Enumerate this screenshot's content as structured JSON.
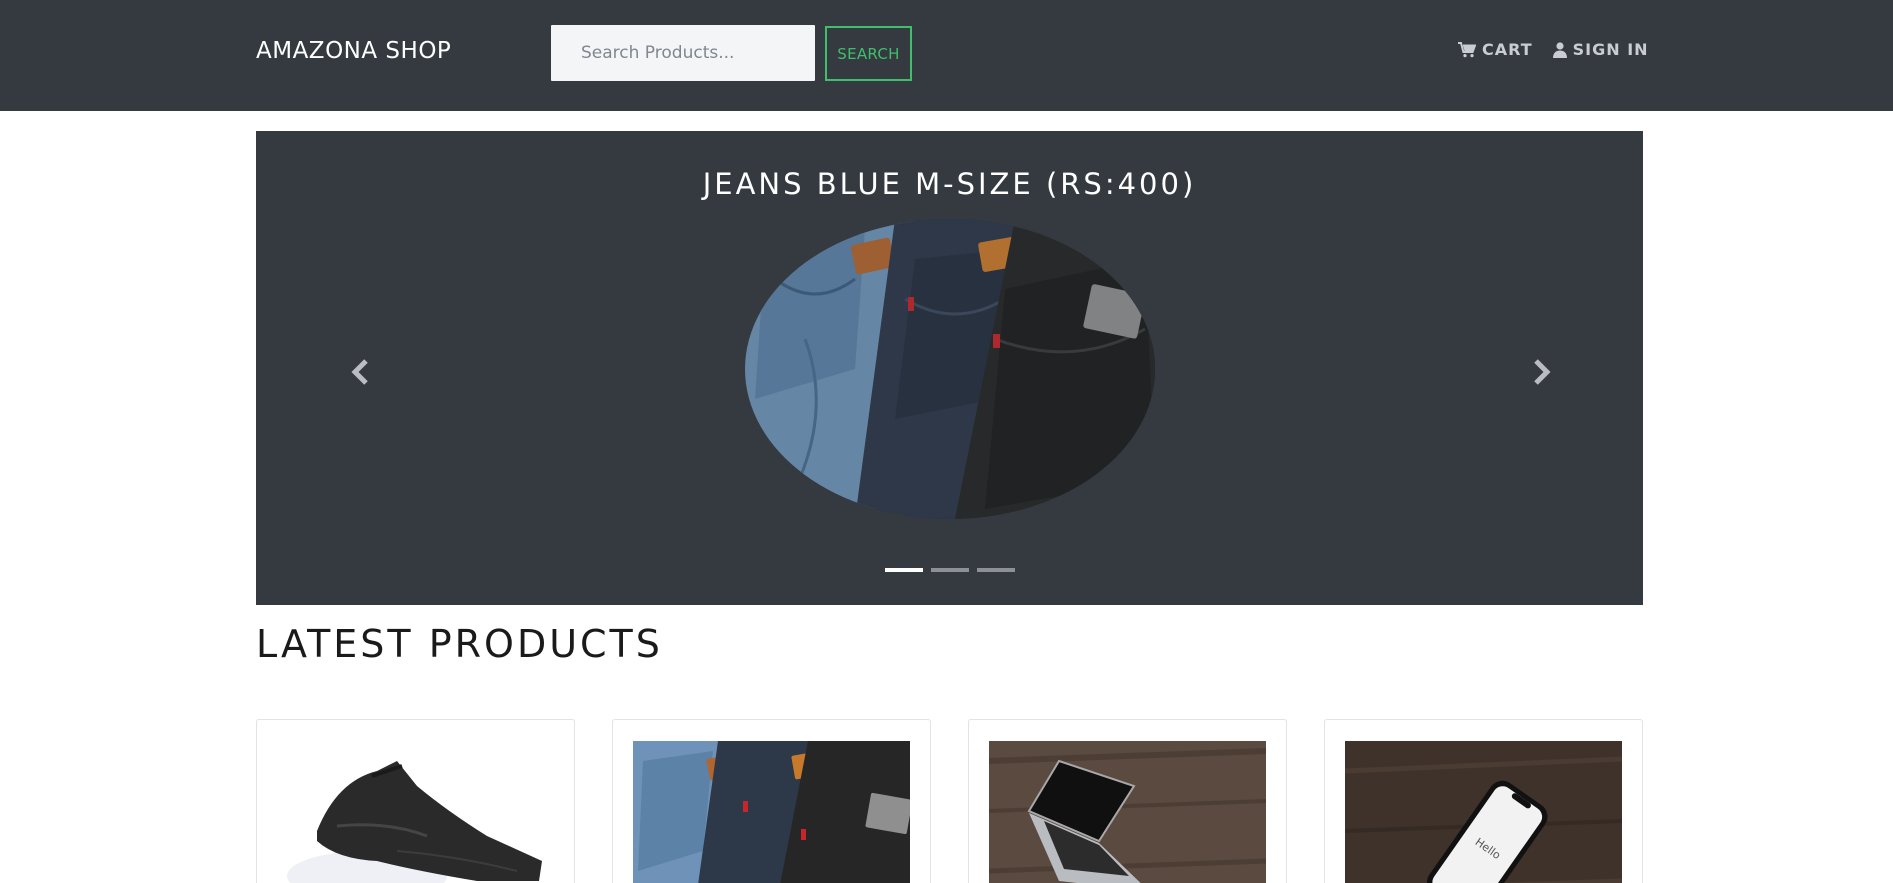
{
  "navbar": {
    "brand": "AMAZONA SHOP",
    "search_placeholder": "Search Products...",
    "search_button": "SEARCH",
    "cart_label": "CART",
    "signin_label": "SIGN IN",
    "cart_icon": "cart-icon",
    "user_icon": "user-icon"
  },
  "carousel": {
    "title": "JEANS BLUE M-SIZE (RS:400)",
    "image": "jeans-stack-photo",
    "prev_icon": "chevron-left-icon",
    "next_icon": "chevron-right-icon",
    "indicators": [
      {
        "active": true
      },
      {
        "active": false
      },
      {
        "active": false
      }
    ]
  },
  "products": {
    "heading": "LATEST PRODUCTS",
    "items": [
      {
        "image": "black-jeans-photo"
      },
      {
        "image": "jeans-stack-photo"
      },
      {
        "image": "laptop-on-wood-photo"
      },
      {
        "image": "phone-on-wood-photo"
      }
    ]
  },
  "colors": {
    "navbar_bg": "#343a40",
    "accent_green": "#3fbf6b",
    "page_bg": "#ffffff"
  }
}
